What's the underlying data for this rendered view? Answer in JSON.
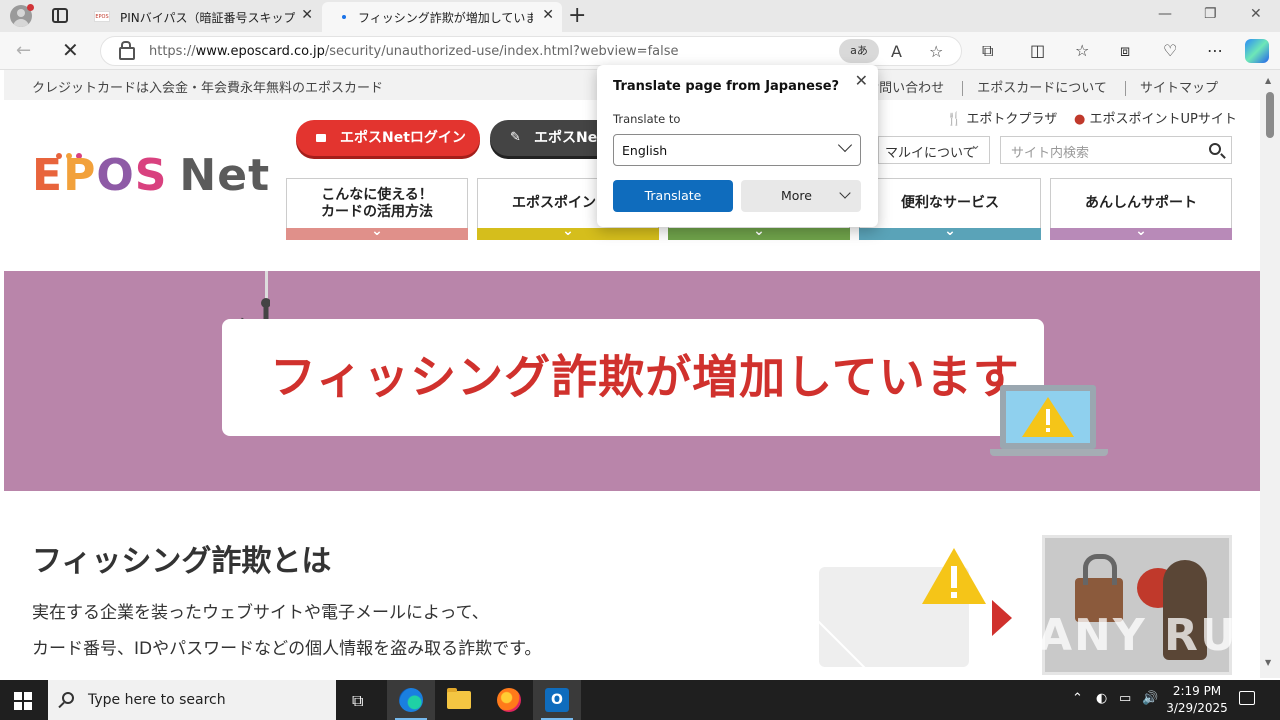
{
  "browser": {
    "tabs": [
      {
        "title": "PINバイパス（暗証番号スキップ機能",
        "favicon": "EPOS"
      },
      {
        "title": "フィッシング詐欺が増加しています | エ"
      }
    ],
    "url": {
      "prefix": "https://",
      "domain": "www.eposcard.co.jp",
      "path": "/security/unauthorized-use/index.html?webview=false"
    },
    "translate_chip": "aあ"
  },
  "translate_popup": {
    "title": "Translate page from Japanese?",
    "label": "Translate to",
    "selected_language": "English",
    "translate_button": "Translate",
    "more_button": "More"
  },
  "site": {
    "tagline": "クレジットカードは入会金・年会費永年無料のエポスカード",
    "util_links": [
      "お問い合わせ",
      "エポスカードについて",
      "サイトマップ"
    ],
    "util_partial": "ほ",
    "sublinks": [
      "エポトクプラザ",
      "エポスポイントUPサイト"
    ],
    "logo": {
      "e": "E",
      "p": "P",
      "o": "O",
      "s": "S",
      "net": "Net"
    },
    "login_button": "エポスNetログイン",
    "new_button": "エポスNet",
    "marui_dropdown": "マルイについて",
    "search_placeholder": "サイト内検索",
    "global_nav": [
      {
        "label_line1": "こんなに使える！",
        "label_line2": "カードの活用方法",
        "color": "#e0908a"
      },
      {
        "label_line1": "エポスポイントに",
        "label_line2": "",
        "color": "#d5be1c"
      },
      {
        "label_line1": "",
        "label_line2": "",
        "color": "#6fa24a"
      },
      {
        "label_line1": "便利なサービス",
        "label_line2": "",
        "color": "#5aa3b8"
      },
      {
        "label_line1": "あんしんサポート",
        "label_line2": "",
        "color": "#b88ab8"
      }
    ],
    "hero_title": "フィッシング詐欺が増加しています",
    "section_title": "フィッシング詐欺とは",
    "section_lines": [
      "実在する企業を装ったウェブサイトや電子メールによって、",
      "カード番号、IDやパスワードなどの個人情報を盗み取る詐欺です。"
    ],
    "watermark": "ANY RUN"
  },
  "taskbar": {
    "search_placeholder": "Type here to search",
    "time": "2:19 PM",
    "date": "3/29/2025"
  },
  "colors": {
    "hero_bg": "#b985aa",
    "hero_title": "#d0312d",
    "login_red": "#e3342f",
    "translate_blue": "#0f6cbd"
  }
}
